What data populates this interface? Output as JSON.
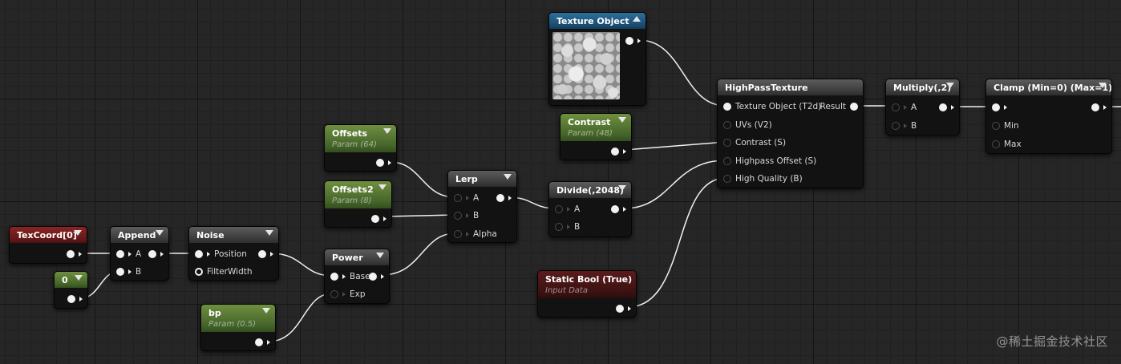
{
  "nodes": {
    "texcoord": {
      "title": "TexCoord[0]"
    },
    "const0": {
      "title": "0"
    },
    "append": {
      "title": "Append",
      "pin_a": "A",
      "pin_b": "B"
    },
    "noise": {
      "title": "Noise",
      "pin_position": "Position",
      "pin_filterwidth": "FilterWidth"
    },
    "offsets": {
      "title": "Offsets",
      "subtitle": "Param (64)"
    },
    "offsets2": {
      "title": "Offsets2",
      "subtitle": "Param (8)"
    },
    "power": {
      "title": "Power",
      "pin_base": "Base",
      "pin_exp": "Exp"
    },
    "bp": {
      "title": "bp",
      "subtitle": "Param (0.5)"
    },
    "lerp": {
      "title": "Lerp",
      "pin_a": "A",
      "pin_b": "B",
      "pin_alpha": "Alpha"
    },
    "texobj": {
      "title": "Texture Object"
    },
    "contrast": {
      "title": "Contrast",
      "subtitle": "Param (48)"
    },
    "divide": {
      "title": "Divide(,2048)",
      "pin_a": "A",
      "pin_b": "B"
    },
    "staticbool": {
      "title": "Static Bool (True)",
      "subtitle": "Input Data"
    },
    "highpass": {
      "title": "HighPassTexture",
      "pin_texobj": "Texture Object (T2d)",
      "pin_uvs": "UVs (V2)",
      "pin_contrast": "Contrast (S)",
      "pin_offset": "Highpass Offset (S)",
      "pin_quality": "High Quality (B)",
      "out_result": "Result"
    },
    "multiply": {
      "title": "Multiply(,2)",
      "pin_a": "A",
      "pin_b": "B"
    },
    "clamp": {
      "title": "Clamp (Min=0) (Max=1)",
      "pin_min": "Min",
      "pin_max": "Max"
    }
  },
  "watermark": "@稀土掘金技术社区",
  "colors": {
    "param_header": "#5a7a35",
    "vector_header": "#7a1f1f",
    "texture_header": "#24618e",
    "input_header": "#4a1616",
    "function_header": "#3a3a3a",
    "wire": "#f0f0f0",
    "grid_bg": "#262626"
  },
  "icons": [
    "collapse-chevron-icon",
    "expand-chevron-icon",
    "pin-connected-icon",
    "pin-unconnected-icon",
    "exec-arrow-icon"
  ]
}
